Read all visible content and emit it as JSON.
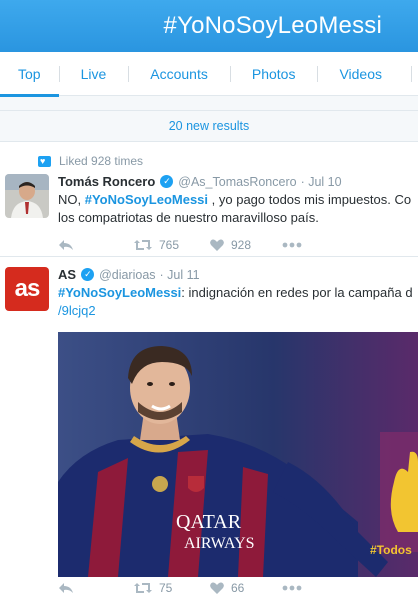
{
  "header": {
    "title": "#YoNoSoyLeoMessi"
  },
  "tabs": [
    {
      "label": "Top",
      "active": true
    },
    {
      "label": "Live",
      "active": false
    },
    {
      "label": "Accounts",
      "active": false
    },
    {
      "label": "Photos",
      "active": false
    },
    {
      "label": "Videos",
      "active": false
    }
  ],
  "new_results": "20 new results",
  "tweets": [
    {
      "context": "Liked 928 times",
      "name": "Tomás Roncero",
      "handle": "@As_TomasRoncero",
      "date": "· Jul 10",
      "line1_pre": "NO, ",
      "line1_hashtag": "#YoNoSoyLeoMessi",
      "line1_post": " , yo pago todos mis impuestos.  Co",
      "line2": "los compatriotas de nuestro maravilloso país.",
      "retweets": "765",
      "likes": "928"
    },
    {
      "name": "AS",
      "handle": "@diarioas",
      "date": "· Jul 11",
      "avatar_text": "as",
      "line1_hashtag": "#YoNoSoyLeoMessi",
      "line1_post": ": indignación en redes por la campaña d",
      "line2_link": "/9lcjq2",
      "retweets": "75",
      "likes": "66",
      "media": {
        "shirt_sponsor_top": "QATAR",
        "shirt_sponsor_bottom": "AIRWAYS",
        "overlay_text": "#Todos"
      }
    }
  ],
  "colors": {
    "accent": "#1b95e0",
    "header": "#2a95e0",
    "muted": "#8899a6"
  }
}
